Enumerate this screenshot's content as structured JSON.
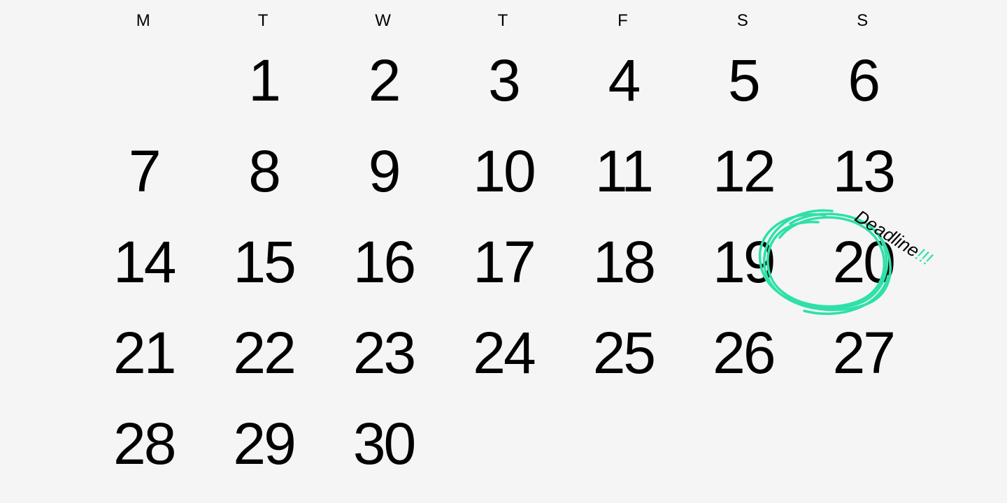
{
  "calendar": {
    "day_headers": [
      "M",
      "T",
      "W",
      "T",
      "F",
      "S",
      "S"
    ],
    "weeks": [
      [
        "",
        "1",
        "2",
        "3",
        "4",
        "5",
        "6"
      ],
      [
        "7",
        "8",
        "9",
        "10",
        "11",
        "12",
        "13"
      ],
      [
        "14",
        "15",
        "16",
        "17",
        "18",
        "19",
        "20"
      ],
      [
        "21",
        "22",
        "23",
        "24",
        "25",
        "26",
        "27"
      ],
      [
        "28",
        "29",
        "30",
        "",
        "",
        "",
        ""
      ]
    ],
    "highlight": {
      "day": "20",
      "label_text": "Deadline",
      "label_punct": "!!!",
      "circle_color": "#2fe0a8"
    }
  }
}
